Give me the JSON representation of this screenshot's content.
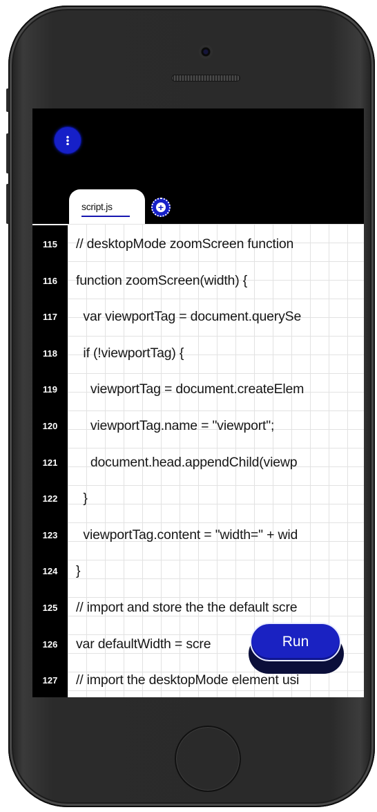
{
  "app": {
    "menu_icon": "vertical-dots-icon",
    "add_tab_icon": "plus-circle-icon"
  },
  "tabs": [
    {
      "label": "script.js",
      "active": true
    }
  ],
  "editor": {
    "lines": [
      {
        "number": "115",
        "text": "// desktopMode zoomScreen function"
      },
      {
        "number": "116",
        "text": "function zoomScreen(width) {"
      },
      {
        "number": "117",
        "text": "  var viewportTag = document.querySe"
      },
      {
        "number": "118",
        "text": "  if (!viewportTag) {"
      },
      {
        "number": "119",
        "text": "    viewportTag = document.createElem"
      },
      {
        "number": "120",
        "text": "    viewportTag.name = \"viewport\";"
      },
      {
        "number": "121",
        "text": "    document.head.appendChild(viewp"
      },
      {
        "number": "122",
        "text": "  }"
      },
      {
        "number": "123",
        "text": "  viewportTag.content = \"width=\" + wid"
      },
      {
        "number": "124",
        "text": "}"
      },
      {
        "number": "125",
        "text": "// import and store the the default scre"
      },
      {
        "number": "126",
        "text": "var defaultWidth = scre"
      },
      {
        "number": "127",
        "text": "// import the desktopMode element usi"
      }
    ]
  },
  "run_button": {
    "label": "Run"
  },
  "colors": {
    "accent": "#1620c8",
    "editor_bg": "#ffffff",
    "gutter_bg": "#000000",
    "phone_body": "#2a2a2a"
  }
}
